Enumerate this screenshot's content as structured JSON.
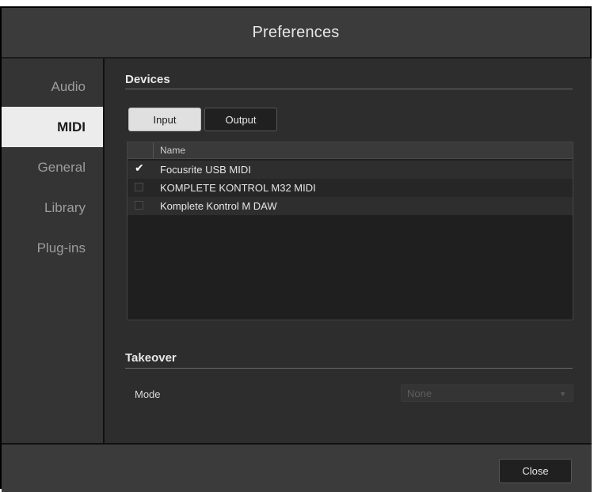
{
  "window": {
    "title": "Preferences"
  },
  "sidebar": {
    "items": [
      {
        "label": "Audio",
        "active": false
      },
      {
        "label": "MIDI",
        "active": true
      },
      {
        "label": "General",
        "active": false
      },
      {
        "label": "Library",
        "active": false
      },
      {
        "label": "Plug-ins",
        "active": false
      }
    ]
  },
  "devices": {
    "title": "Devices",
    "tabs": {
      "input": "Input",
      "output": "Output",
      "selected": "Input"
    },
    "table": {
      "header": "Name",
      "rows": [
        {
          "name": "Focusrite USB MIDI",
          "checked": true
        },
        {
          "name": "KOMPLETE KONTROL M32 MIDI",
          "checked": false
        },
        {
          "name": "Komplete Kontrol M DAW",
          "checked": false
        }
      ]
    }
  },
  "takeover": {
    "title": "Takeover",
    "mode_label": "Mode",
    "mode_value": "None"
  },
  "footer": {
    "close_label": "Close"
  },
  "icons": {
    "check": "✔",
    "caret": "▼"
  }
}
